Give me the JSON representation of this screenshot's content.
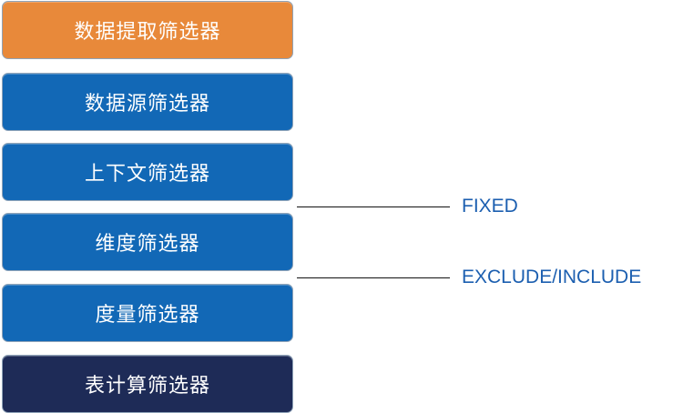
{
  "filters": [
    {
      "label": "数据提取筛选器",
      "color": "#e8893a"
    },
    {
      "label": "数据源筛选器",
      "color": "#1268b6"
    },
    {
      "label": "上下文筛选器",
      "color": "#1268b6"
    },
    {
      "label": "维度筛选器",
      "color": "#1268b6"
    },
    {
      "label": "度量筛选器",
      "color": "#1268b6"
    },
    {
      "label": "表计算筛选器",
      "color": "#1e2b57"
    }
  ],
  "annotations": {
    "fixed": "FIXED",
    "exclude_include": "EXCLUDE/INCLUDE"
  },
  "colors": {
    "annotation_text": "#1c5fb0",
    "connector_line": "#111111"
  }
}
